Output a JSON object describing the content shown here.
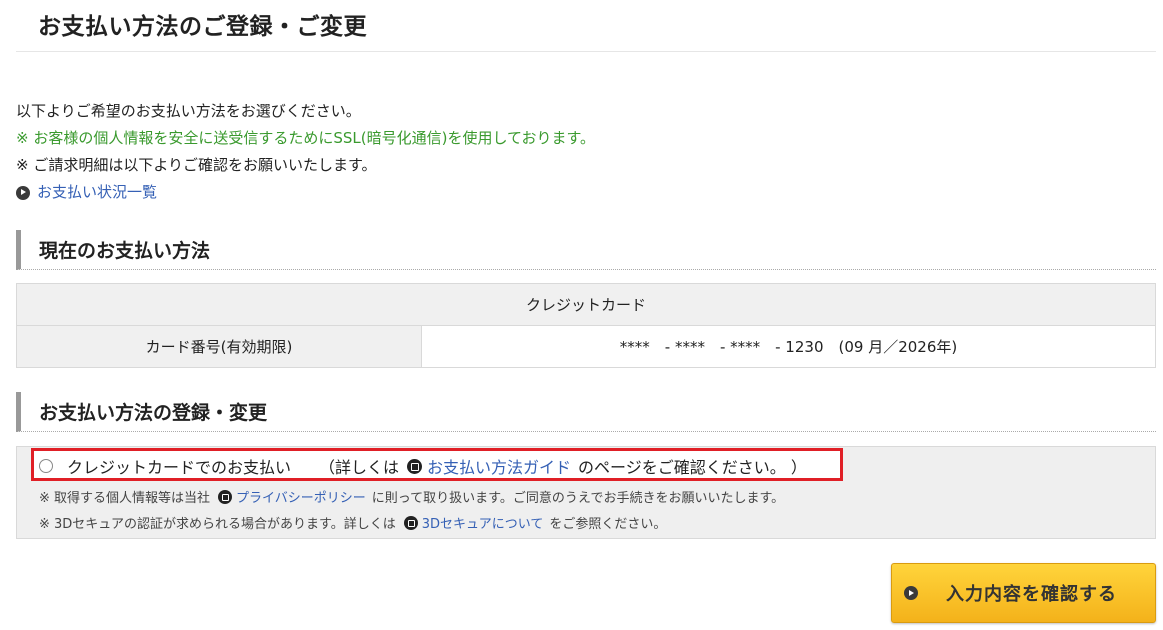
{
  "page": {
    "title": "お支払い方法のご登録・ご変更"
  },
  "intro": {
    "line1": "以下よりご希望のお支払い方法をお選びください。",
    "ssl_note": "※ お客様の個人情報を安全に送受信するためにSSL(暗号化通信)を使用しております。",
    "billing_note": "※ ご請求明細は以下よりご確認をお願いいたします。",
    "status_link": "お支払い状況一覧"
  },
  "current": {
    "heading": "現在のお支払い方法",
    "method": "クレジットカード",
    "card_label": "カード番号(有効期限)",
    "card_value": "****　- ****　- ****　- 1230　(09 月／2026年)"
  },
  "register": {
    "heading": "お支払い方法の登録・変更",
    "option_label": "クレジットカードでのお支払い",
    "detail_prefix": "（詳しくは",
    "guide_link": "お支払い方法ガイド",
    "detail_suffix": "のページをご確認ください。 ）",
    "note1_prefix": "※ 取得する個人情報等は当社",
    "privacy_link": "プライバシーポリシー",
    "note1_suffix": "に則って取り扱います。ご同意のうえでお手続きをお願いいたします。",
    "note2_prefix": "※ 3Dセキュアの認証が求められる場合があります。詳しくは",
    "secure_link": "3Dセキュアについて",
    "note2_suffix": "をご参照ください。"
  },
  "actions": {
    "confirm_label": "入力内容を確認する"
  },
  "colors": {
    "accent_green": "#3a9a2e",
    "link": "#3560b5",
    "highlight_red": "#e01f26",
    "button_yellow": "#f4b21a"
  }
}
